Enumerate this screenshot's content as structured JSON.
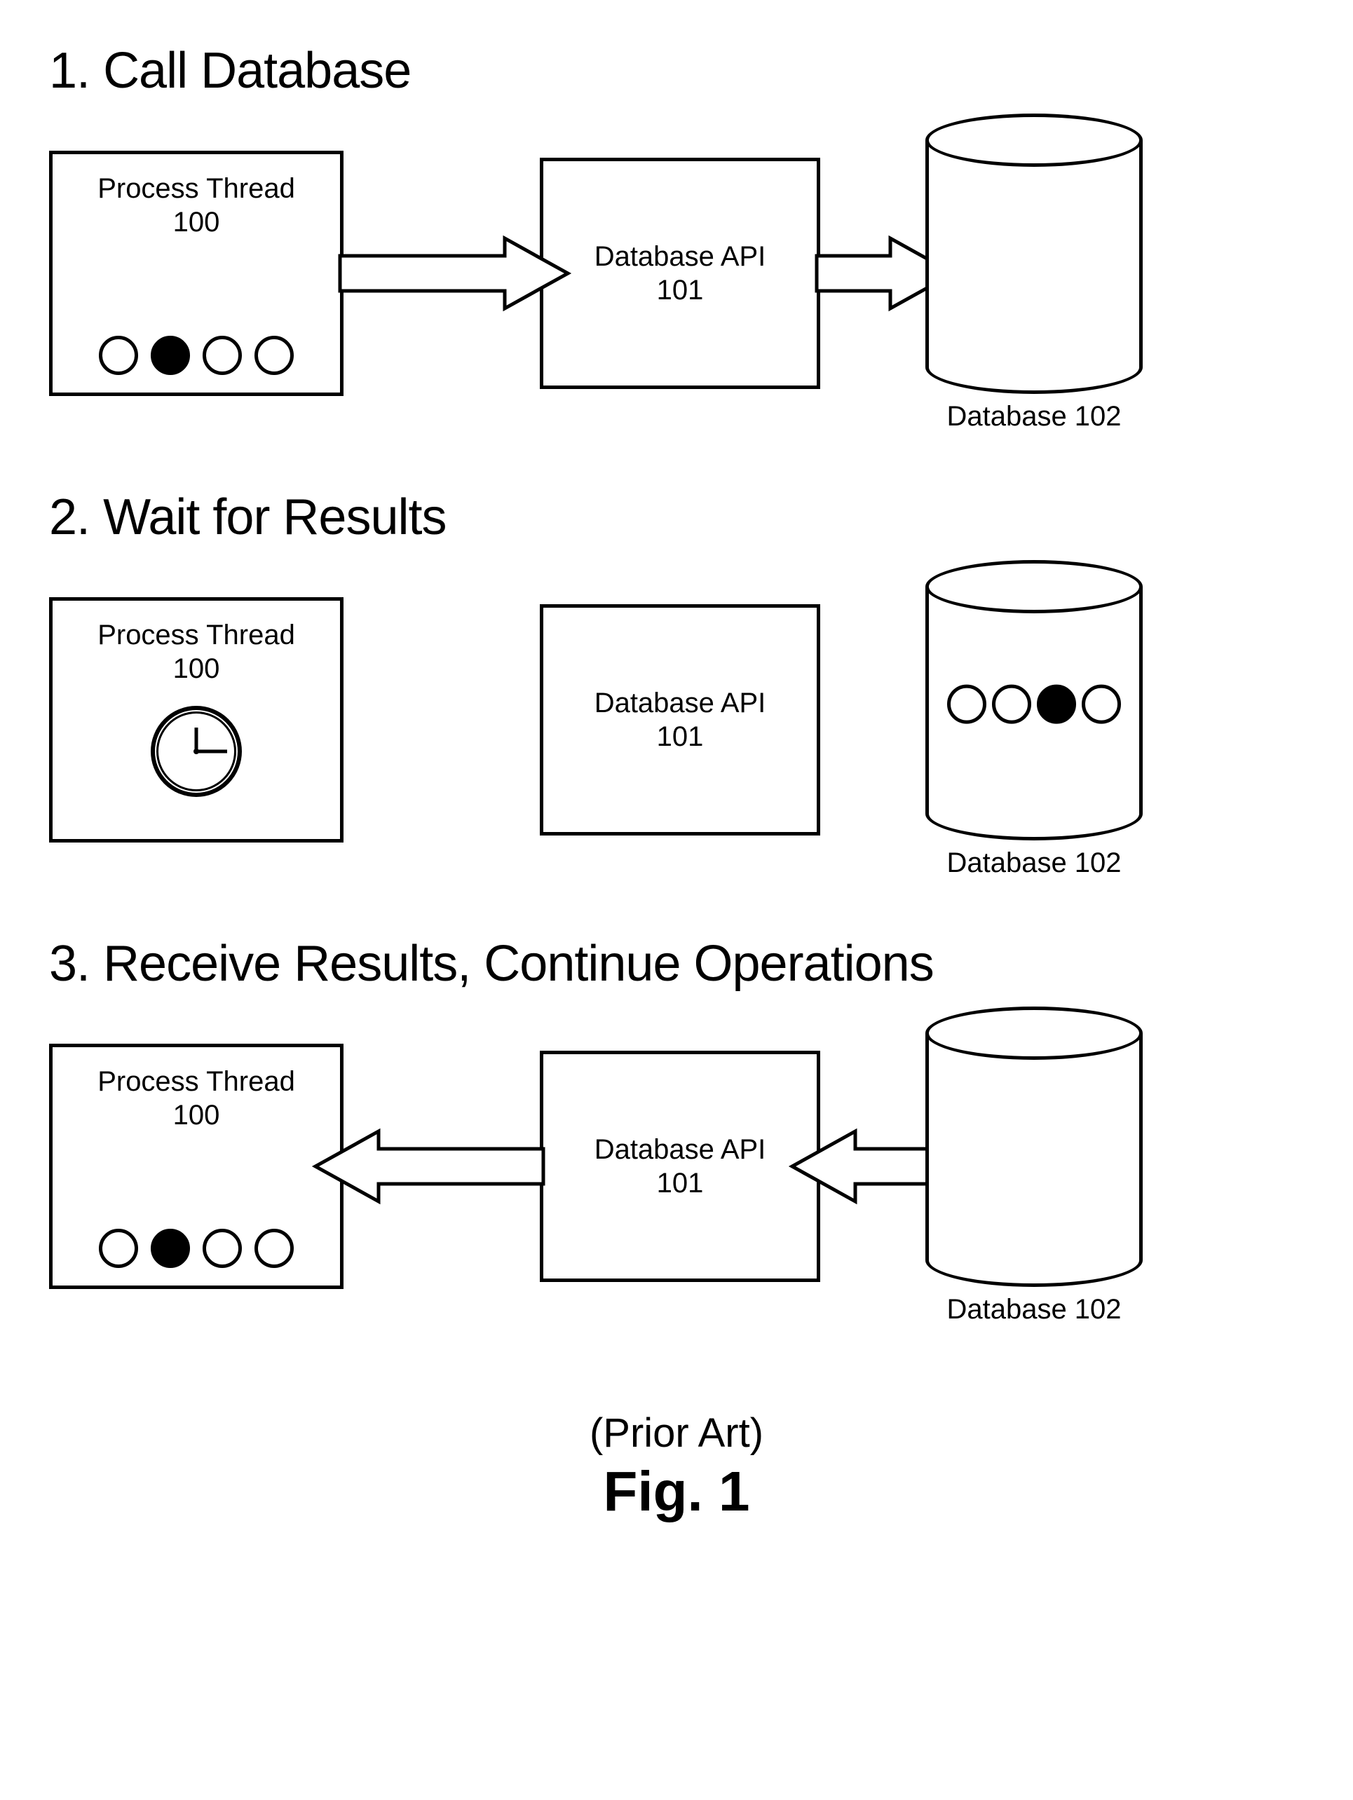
{
  "sections": [
    {
      "num": "1.",
      "title": "Call Database"
    },
    {
      "num": "2.",
      "title": "Wait for Results"
    },
    {
      "num": "3.",
      "title": "Receive Results, Continue Operations"
    }
  ],
  "process": {
    "label_line1": "Process Thread",
    "label_line2": "100"
  },
  "api": {
    "label_line1": "Database API",
    "label_line2": "101"
  },
  "database": {
    "label": "Database 102"
  },
  "footer": {
    "prior_art": "(Prior Art)",
    "fig": "Fig. 1"
  }
}
